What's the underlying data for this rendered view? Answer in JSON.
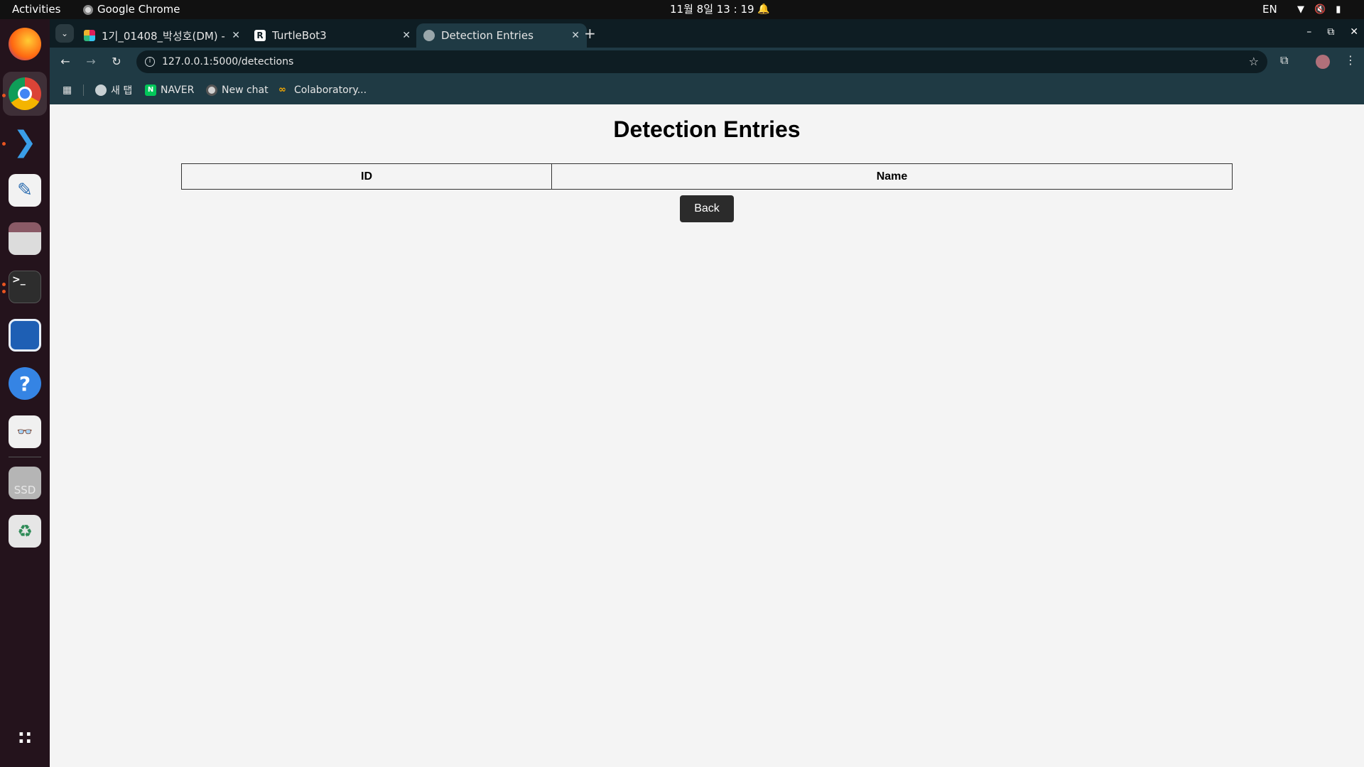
{
  "topbar": {
    "activities": "Activities",
    "app_name": "Google Chrome",
    "clock": "11월 8일  13 : 19",
    "language": "EN"
  },
  "dock": {
    "items": [
      "firefox-icon",
      "chrome-icon",
      "vscode-icon",
      "text-editor-icon",
      "files-icon",
      "terminal-icon",
      "libreoffice-writer-icon",
      "help-icon",
      "document-viewer-icon",
      "ssd-drive-icon",
      "trash-icon",
      "app-grid-icon"
    ],
    "ssd_label": "SSD"
  },
  "tabs": [
    {
      "title": "1기_01408_박성호(DM) -",
      "icon": "slack-icon"
    },
    {
      "title": "TurtleBot3",
      "icon": "robotis-icon"
    },
    {
      "title": "Detection Entries",
      "icon": "globe-icon",
      "active": true
    }
  ],
  "toolbar": {
    "url": "127.0.0.1:5000/detections"
  },
  "bookmarks": [
    {
      "label": "새 탭",
      "icon": "globe-icon"
    },
    {
      "label": "NAVER",
      "icon": "naver-icon"
    },
    {
      "label": "New chat",
      "icon": "openai-icon"
    },
    {
      "label": "Colaboratory...",
      "icon": "colab-icon"
    }
  ],
  "page": {
    "title": "Detection Entries",
    "table": {
      "headers": [
        "ID",
        "Name"
      ],
      "rows": []
    },
    "back_button": "Back"
  },
  "colors": {
    "tab_strip": "#0e1d23",
    "toolbar": "#1f3a44",
    "page_bg": "#f4f4f4",
    "button_bg": "#2b2b2b"
  }
}
